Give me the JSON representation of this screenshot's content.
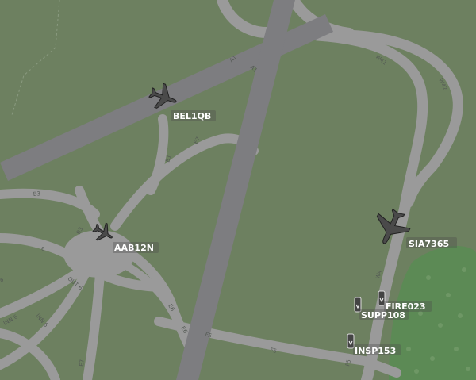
{
  "map": {
    "colors": {
      "grass": "#6d8060",
      "grass_dark": "#5f7a56",
      "trees": "#5c8a55",
      "taxiway": "#9a9a9a",
      "taxiway_edge": "#aaaaaa",
      "runway": "#7d7d80",
      "label": "#555b55",
      "callsign_text": "#ffffff",
      "aircraft_icon": "#333333"
    },
    "taxiway_labels": [
      "A1",
      "A1",
      "W41",
      "W42",
      "E7",
      "B1",
      "B3",
      "B3",
      "OUT 6",
      "INN 6",
      "INN 6",
      "E6",
      "E6",
      "F5",
      "F5",
      "F5",
      "W4",
      "E7",
      "6",
      "6"
    ],
    "aircraft": [
      {
        "callsign": "BEL1QB",
        "icon": "airliner-icon",
        "heading_deg": 110
      },
      {
        "callsign": "AAB12N",
        "icon": "small-aircraft-icon",
        "heading_deg": 120
      },
      {
        "callsign": "SIA7365",
        "icon": "widebody-aircraft-icon",
        "heading_deg": 205
      }
    ],
    "vehicles": [
      {
        "callsign": "FIRE023",
        "icon": "fire-truck-icon"
      },
      {
        "callsign": "SUPP108",
        "icon": "support-vehicle-icon"
      },
      {
        "callsign": "INSP153",
        "icon": "inspection-vehicle-icon"
      }
    ]
  }
}
